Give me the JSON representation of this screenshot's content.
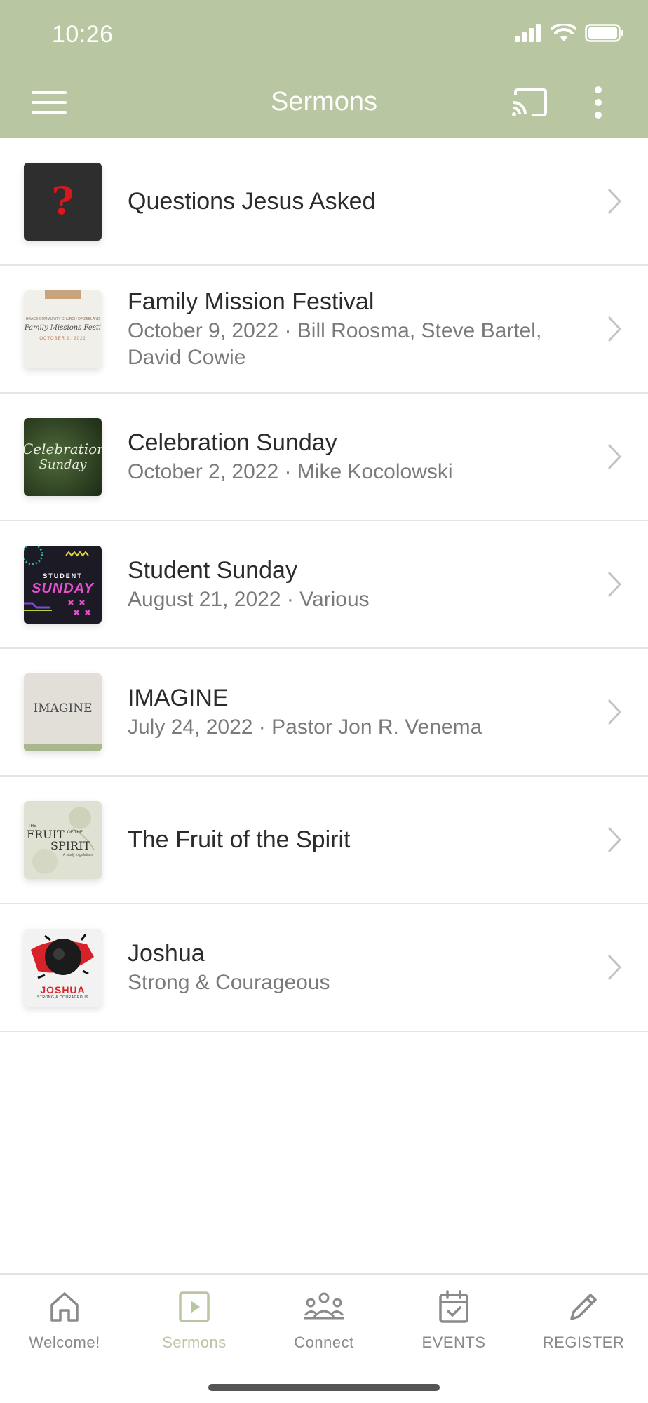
{
  "status_bar": {
    "time": "10:26"
  },
  "toolbar": {
    "title": "Sermons"
  },
  "sermons": [
    {
      "title": "Questions Jesus Asked",
      "subtitle": ""
    },
    {
      "title": "Family Mission Festival",
      "subtitle": "October 9, 2022 · Bill Roosma, Steve Bartel, David Cowie"
    },
    {
      "title": "Celebration Sunday",
      "subtitle": "October 2, 2022 · Mike Kocolowski"
    },
    {
      "title": "Student Sunday",
      "subtitle": "August 21, 2022 · Various"
    },
    {
      "title": "IMAGINE",
      "subtitle": "July 24, 2022 · Pastor Jon R. Venema"
    },
    {
      "title": "The Fruit of the Spirit",
      "subtitle": ""
    },
    {
      "title": "Joshua",
      "subtitle": "Strong & Courageous"
    }
  ],
  "thumbs": {
    "questions": {
      "glyph": "?"
    },
    "family": {
      "line1": "GRACE COMMUNITY CHURCH OF ZEELAND",
      "line2": "Family Missions Festi",
      "line3": "OCTOBER 9, 2022"
    },
    "celebration": {
      "line1": "Celebration",
      "line2": "Sunday"
    },
    "student": {
      "line1": "STUDENT",
      "line2": "SUNDAY"
    },
    "imagine": {
      "text": "IMAGINE"
    },
    "fruit": {
      "line1": "FRUIT",
      "line2": "SPIRIT",
      "small1": "THE",
      "small2": "OF THE",
      "small3": "A study in galatians"
    },
    "joshua": {
      "line1": "JOSHUA",
      "line2": "STRONG & COURAGEOUS"
    }
  },
  "bottom_nav": [
    {
      "label": "Welcome!",
      "icon": "home-icon"
    },
    {
      "label": "Sermons",
      "icon": "play-icon"
    },
    {
      "label": "Connect",
      "icon": "people-icon"
    },
    {
      "label": "EVENTS",
      "icon": "calendar-icon"
    },
    {
      "label": "REGISTER",
      "icon": "pencil-icon"
    }
  ],
  "colors": {
    "brand": "#b8c6a1",
    "inactive": "#8a8a8a"
  }
}
